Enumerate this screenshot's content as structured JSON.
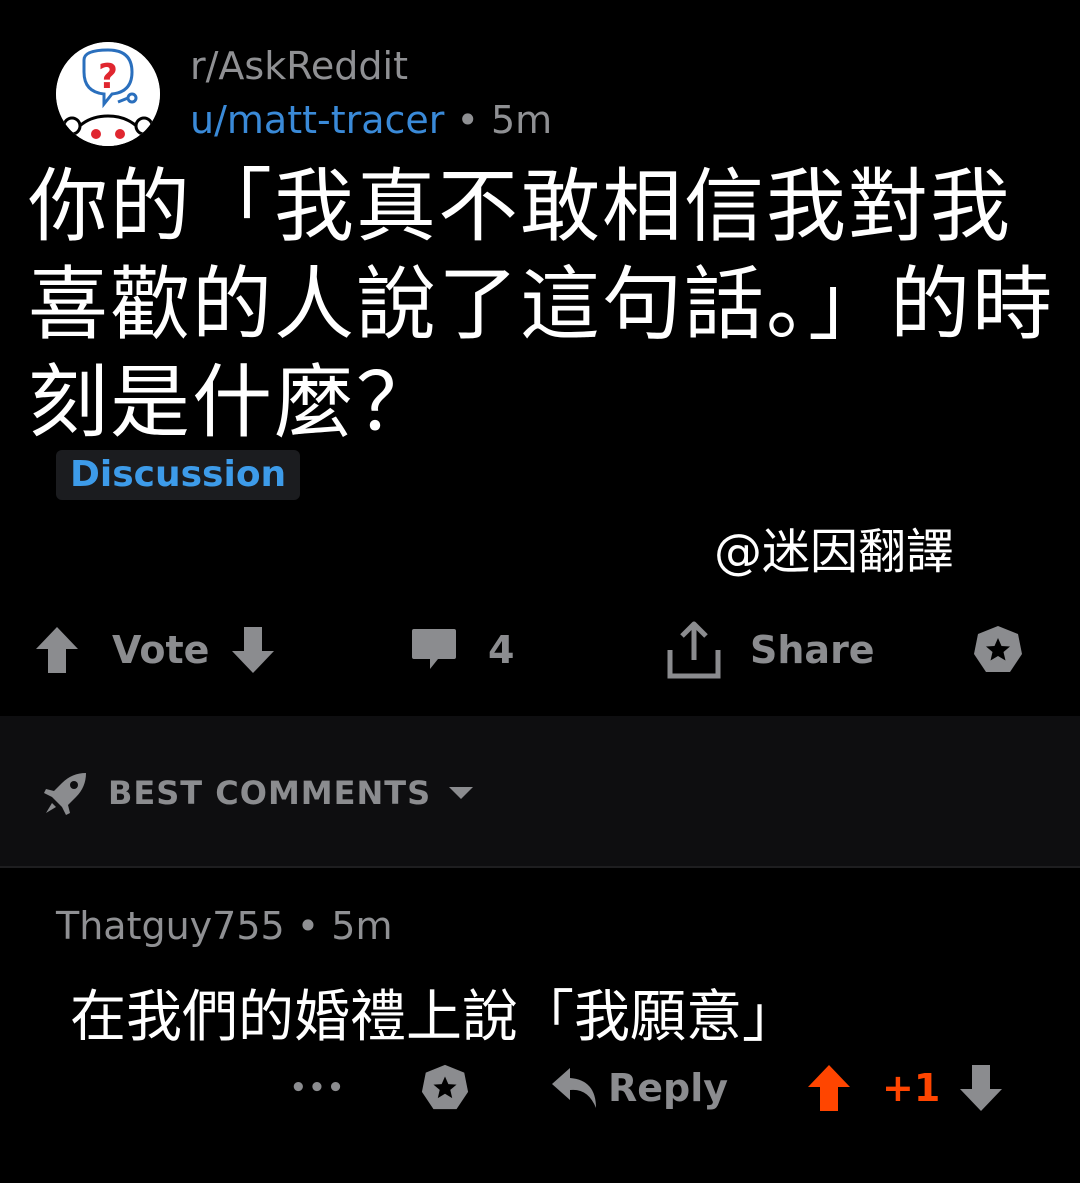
{
  "post": {
    "subreddit": "r/AskReddit",
    "author": "u/matt-tracer",
    "separator": " • ",
    "time": "5m",
    "title": "你的「我真不敢相信我對我喜歡的人說了這句話。」的時刻是什麼？",
    "flair": "Discussion",
    "watermark": "@迷因翻譯"
  },
  "actions": {
    "vote_label": "Vote",
    "comment_count": "4",
    "share_label": "Share"
  },
  "sort": {
    "label": "BEST COMMENTS"
  },
  "comment": {
    "author": "Thatguy755",
    "separator": " • ",
    "time": "5m",
    "body": "在我們的婚禮上說「我願意」",
    "more_label": "•••",
    "reply_label": "Reply",
    "score": "+1"
  },
  "colors": {
    "background": "#000000",
    "link_blue": "#3a8ad8",
    "flair_blue": "#3d9be9",
    "muted_gray": "#8b8c8f",
    "upvote_orange": "#ff4500"
  },
  "icons": {
    "avatar": "askreddit-snoo-icon",
    "upvote": "arrow-up-icon",
    "downvote": "arrow-down-icon",
    "comments": "speech-bubble-icon",
    "share": "share-icon",
    "award": "award-icon",
    "sort": "rocket-icon",
    "dropdown": "caret-down-icon",
    "reply": "reply-arrow-icon"
  }
}
